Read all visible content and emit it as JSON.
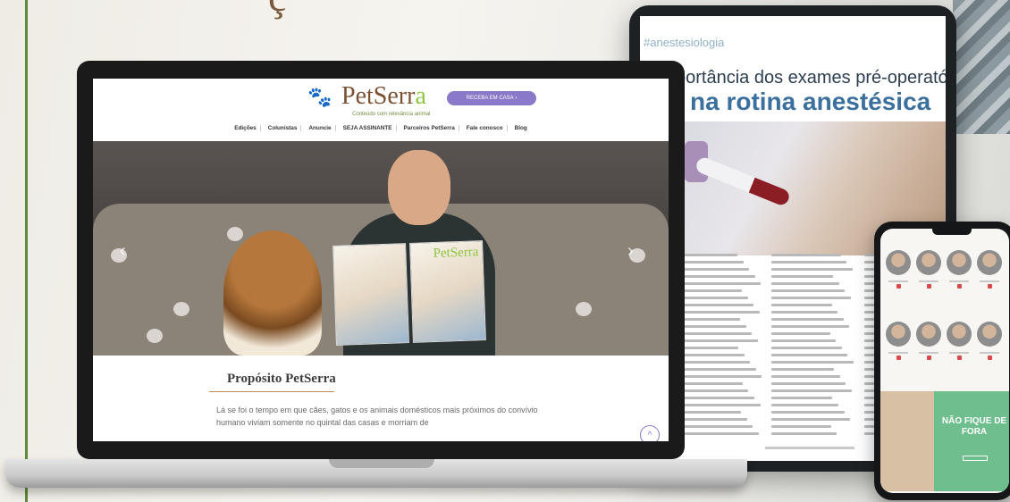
{
  "tablet": {
    "tag": "#anestesiologia",
    "title_line1": "portância dos exames pré-operatórios",
    "title_line2": "na rotina anestésica"
  },
  "site": {
    "logo_main": "PetSerr",
    "logo_accent": "a",
    "tagline": "Conteúdo com relevância animal",
    "subscribe_label": "RECEBA EM CASA",
    "nav": [
      "Edições",
      "Colunistas",
      "Anuncie",
      "SEJA ASSINANTE",
      "Parceiros PetSerra",
      "Fale conosco",
      "Blog"
    ],
    "hero_magazine_logo": "PetSerra",
    "section_title": "Propósito PetSerra",
    "body_text": "Lá se foi o tempo em que cães, gatos e os animais domésticos mais próximos do convívio humano viviam somente no quintal das casas e morriam de"
  },
  "phone": {
    "banner_text": "NÃO FIQUE DE FORA"
  },
  "colors": {
    "brand_green": "#8ec641",
    "brand_brown": "#7a5233",
    "accent_purple": "#8a78c8",
    "tablet_blue": "#3a6f9e"
  },
  "icons": {
    "logo": "paw-icon",
    "prev": "chevron-left-icon",
    "next": "chevron-right-icon",
    "scroll_top": "chevron-up-icon"
  }
}
